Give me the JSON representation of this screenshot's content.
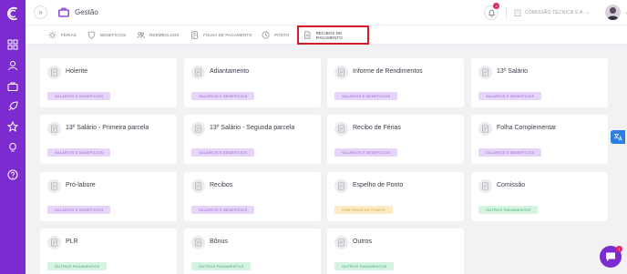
{
  "header": {
    "expand_glyph": "»",
    "module_title": "Gestão",
    "notification_count": "3",
    "company_name": "COMISSÃO TÉCNICA S.A.",
    "chevron": "⌄"
  },
  "tabs": [
    {
      "label": "FÉRIAS",
      "icon": "sun-icon"
    },
    {
      "label": "BENEFÍCIOS",
      "icon": "shield-icon"
    },
    {
      "label": "REEMBOLSOS",
      "icon": "people-icon"
    },
    {
      "label": "FOLHA DE PAGAMENTO",
      "icon": "document-icon"
    },
    {
      "label": "PONTO",
      "icon": "clock-icon"
    },
    {
      "label": "RECIBOS DE PAGAMENTO",
      "icon": "receipt-icon",
      "active": true
    }
  ],
  "cards": [
    {
      "title": "Holerite",
      "badge": "SALÁRIOS E BENEFÍCIOS"
    },
    {
      "title": "Adiantamento",
      "badge": "SALÁRIOS E BENEFÍCIOS"
    },
    {
      "title": "Informe de Rendimentos",
      "badge": "SALÁRIOS E BENEFÍCIOS"
    },
    {
      "title": "13º Salário",
      "badge": "SALÁRIOS E BENEFÍCIOS"
    },
    {
      "title": "13º Salário - Primeira parcela",
      "badge": "SALÁRIOS E BENEFÍCIOS"
    },
    {
      "title": "13º Salário - Segunda parcela",
      "badge": "SALÁRIOS E BENEFÍCIOS"
    },
    {
      "title": "Recibo de Férias",
      "badge": "SALÁRIOS E BENEFÍCIOS"
    },
    {
      "title": "Folha Complementar",
      "badge": "SALÁRIOS E BENEFÍCIOS"
    },
    {
      "title": "Pró-labore",
      "badge": "SALÁRIOS E BENEFÍCIOS"
    },
    {
      "title": "Recibos",
      "badge": "SALÁRIOS E BENEFÍCIOS"
    },
    {
      "title": "Espelho de Ponto",
      "badge": "CONTROLE DE PONTO"
    },
    {
      "title": "Comissão",
      "badge": "OUTROS PAGAMENTOS"
    },
    {
      "title": "PLR",
      "badge": "OUTROS PAGAMENTOS"
    },
    {
      "title": "Bônus",
      "badge": "OUTROS PAGAMENTOS"
    },
    {
      "title": "Outros",
      "badge": "OUTROS PAGAMENTOS"
    }
  ],
  "chat": {
    "badge_count": "1"
  },
  "colors": {
    "sidebar": "#7b2bd0",
    "active_tab_border": "#d8182b",
    "badge_salarios_bg": "#e6d4f9",
    "badge_ponto_bg": "#fcebc4",
    "badge_outros_bg": "#d5f3e1",
    "translate_button": "#2a7ee4"
  }
}
